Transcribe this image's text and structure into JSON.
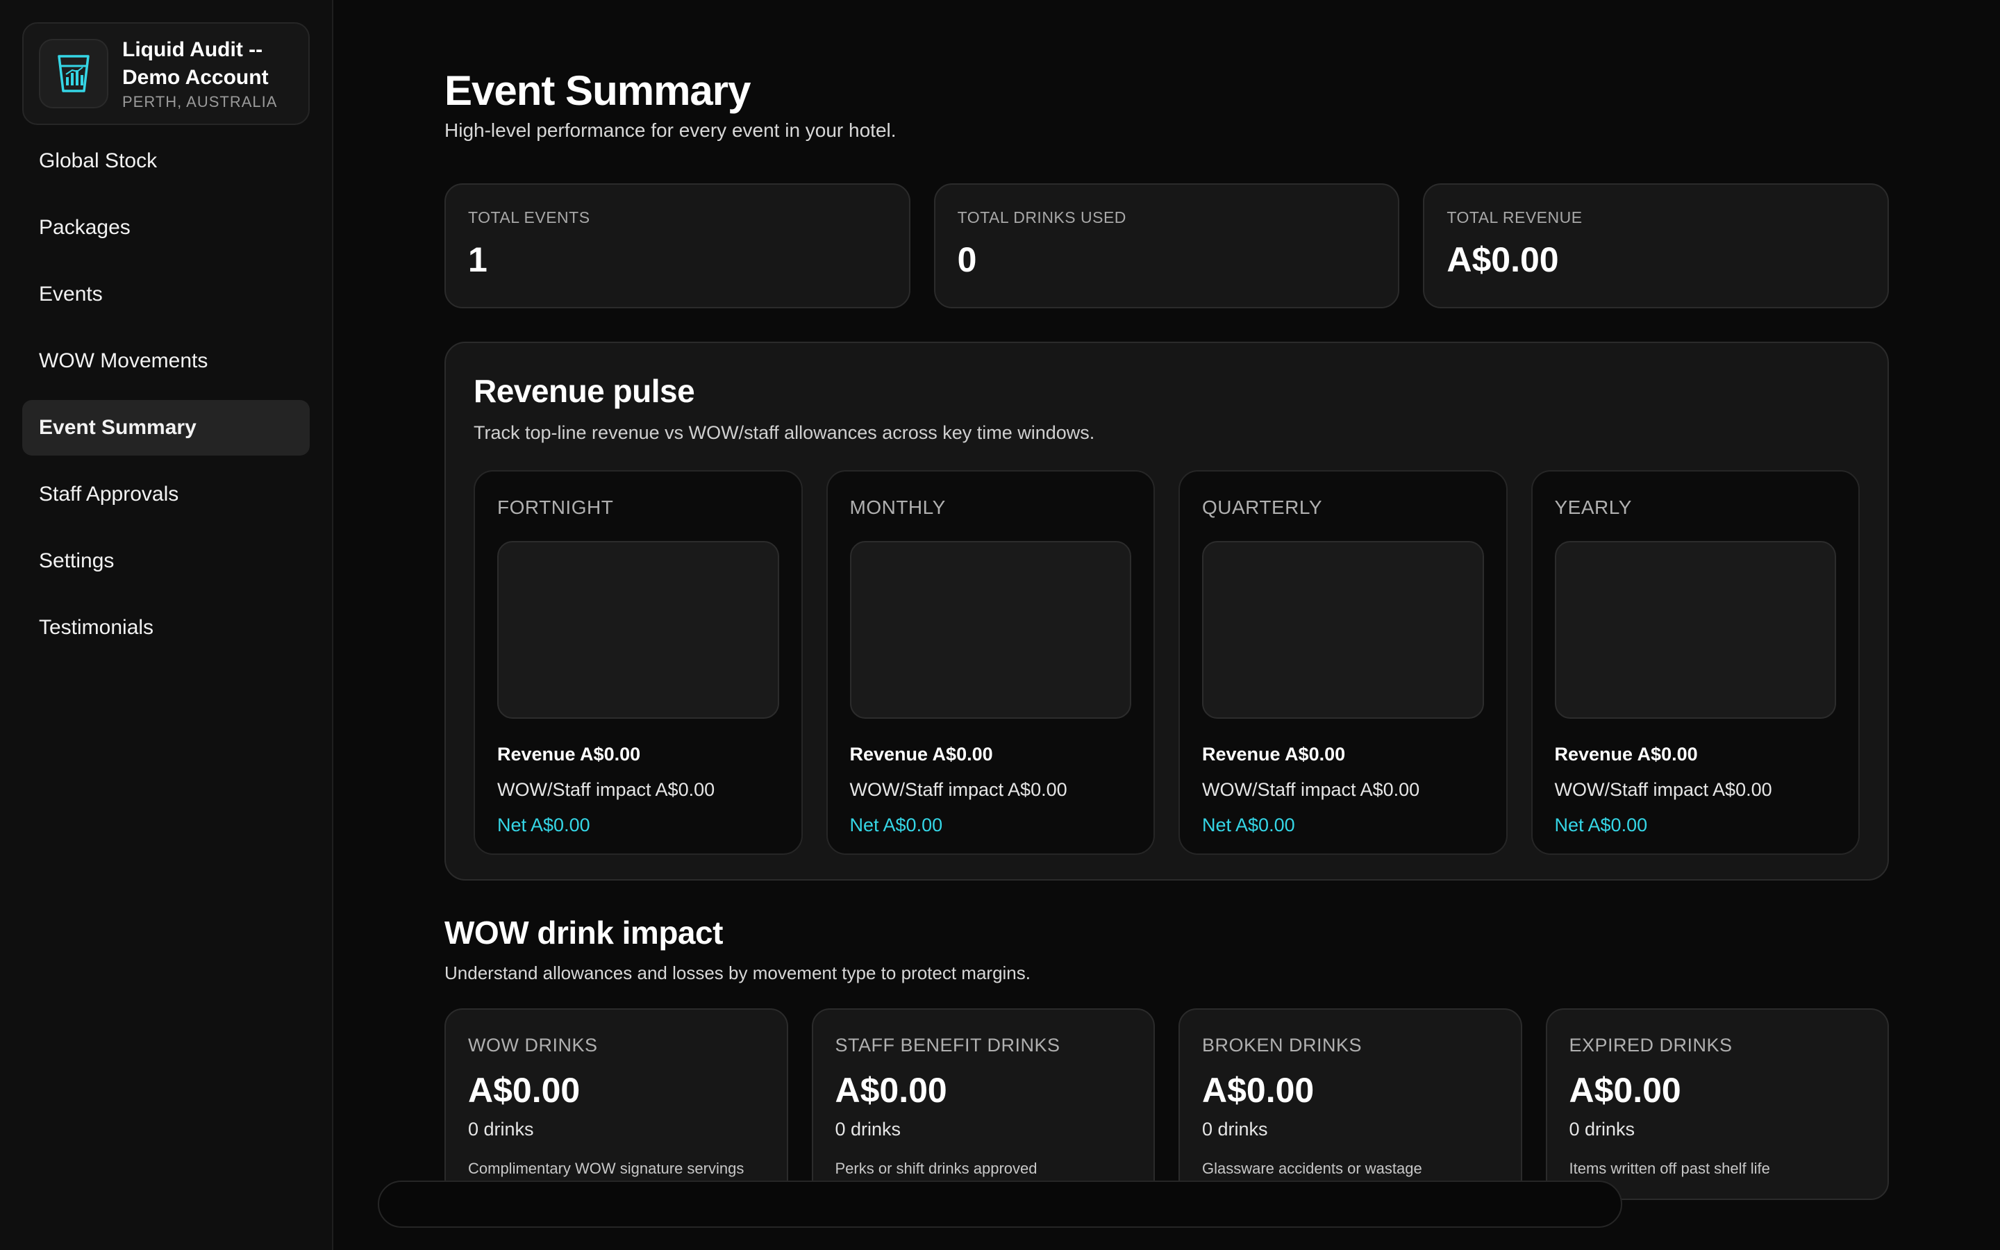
{
  "brand": {
    "name": "Liquid Audit -- Demo Account",
    "location": "PERTH, AUSTRALIA",
    "logo_icon": "glass-chart-icon",
    "accent": "#35d6e6"
  },
  "sidebar": {
    "items": [
      {
        "label": "Global Stock",
        "active": false
      },
      {
        "label": "Packages",
        "active": false
      },
      {
        "label": "Events",
        "active": false
      },
      {
        "label": "WOW Movements",
        "active": false
      },
      {
        "label": "Event Summary",
        "active": true
      },
      {
        "label": "Staff Approvals",
        "active": false
      },
      {
        "label": "Settings",
        "active": false
      },
      {
        "label": "Testimonials",
        "active": false
      }
    ]
  },
  "header": {
    "title": "Event Summary",
    "subtitle": "High-level performance for every event in your hotel."
  },
  "stats": [
    {
      "label": "TOTAL EVENTS",
      "value": "1"
    },
    {
      "label": "TOTAL DRINKS USED",
      "value": "0"
    },
    {
      "label": "TOTAL REVENUE",
      "value": "A$0.00"
    }
  ],
  "pulse": {
    "title": "Revenue pulse",
    "subtitle": "Track top-line revenue vs WOW/staff allowances across key time windows.",
    "periods": [
      {
        "label": "FORTNIGHT",
        "revenue": "Revenue A$0.00",
        "impact": "WOW/Staff impact A$0.00",
        "net": "Net A$0.00"
      },
      {
        "label": "MONTHLY",
        "revenue": "Revenue A$0.00",
        "impact": "WOW/Staff impact A$0.00",
        "net": "Net A$0.00"
      },
      {
        "label": "QUARTERLY",
        "revenue": "Revenue A$0.00",
        "impact": "WOW/Staff impact A$0.00",
        "net": "Net A$0.00"
      },
      {
        "label": "YEARLY",
        "revenue": "Revenue A$0.00",
        "impact": "WOW/Staff impact A$0.00",
        "net": "Net A$0.00"
      }
    ]
  },
  "wow": {
    "title": "WOW drink impact",
    "subtitle": "Understand allowances and losses by movement type to protect margins.",
    "cards": [
      {
        "label": "WOW DRINKS",
        "amount": "A$0.00",
        "count": "0 drinks",
        "desc": "Complimentary WOW signature servings"
      },
      {
        "label": "STAFF BENEFIT DRINKS",
        "amount": "A$0.00",
        "count": "0 drinks",
        "desc": "Perks or shift drinks approved"
      },
      {
        "label": "BROKEN DRINKS",
        "amount": "A$0.00",
        "count": "0 drinks",
        "desc": "Glassware accidents or wastage"
      },
      {
        "label": "EXPIRED DRINKS",
        "amount": "A$0.00",
        "count": "0 drinks",
        "desc": "Items written off past shelf life"
      }
    ]
  }
}
